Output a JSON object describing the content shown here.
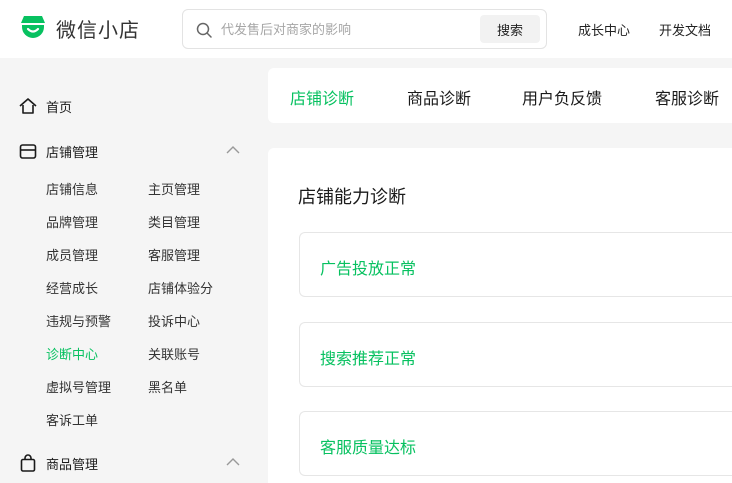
{
  "header": {
    "logo_text": "微信小店",
    "search": {
      "placeholder": "代发售后对商家的影响",
      "button_label": "搜索"
    },
    "links": {
      "growth_center": "成长中心",
      "dev_docs": "开发文档"
    }
  },
  "colors": {
    "accent": "#07c160",
    "page_bg": "#f5f5f5"
  },
  "sidebar": {
    "home": {
      "label": "首页",
      "icon": "home-icon"
    },
    "store_management": {
      "label": "店铺管理",
      "icon": "store-icon",
      "expanded": true,
      "items": [
        {
          "label": "店铺信息"
        },
        {
          "label": "主页管理"
        },
        {
          "label": "品牌管理"
        },
        {
          "label": "类目管理"
        },
        {
          "label": "成员管理"
        },
        {
          "label": "客服管理"
        },
        {
          "label": "经营成长"
        },
        {
          "label": "店铺体验分"
        },
        {
          "label": "违规与预警"
        },
        {
          "label": "投诉中心"
        },
        {
          "label": "诊断中心",
          "active": true
        },
        {
          "label": "关联账号"
        },
        {
          "label": "虚拟号管理"
        },
        {
          "label": "黑名单"
        },
        {
          "label": "客诉工单"
        }
      ]
    },
    "product_management": {
      "label": "商品管理",
      "icon": "shopping-bag-icon",
      "expanded": true
    }
  },
  "tabs": [
    {
      "label": "店铺诊断",
      "active": true
    },
    {
      "label": "商品诊断"
    },
    {
      "label": "用户负反馈"
    },
    {
      "label": "客服诊断"
    }
  ],
  "main": {
    "title": "店铺能力诊断",
    "cards": [
      {
        "label": "广告投放正常"
      },
      {
        "label": "搜索推荐正常"
      },
      {
        "label": "客服质量达标"
      }
    ]
  }
}
